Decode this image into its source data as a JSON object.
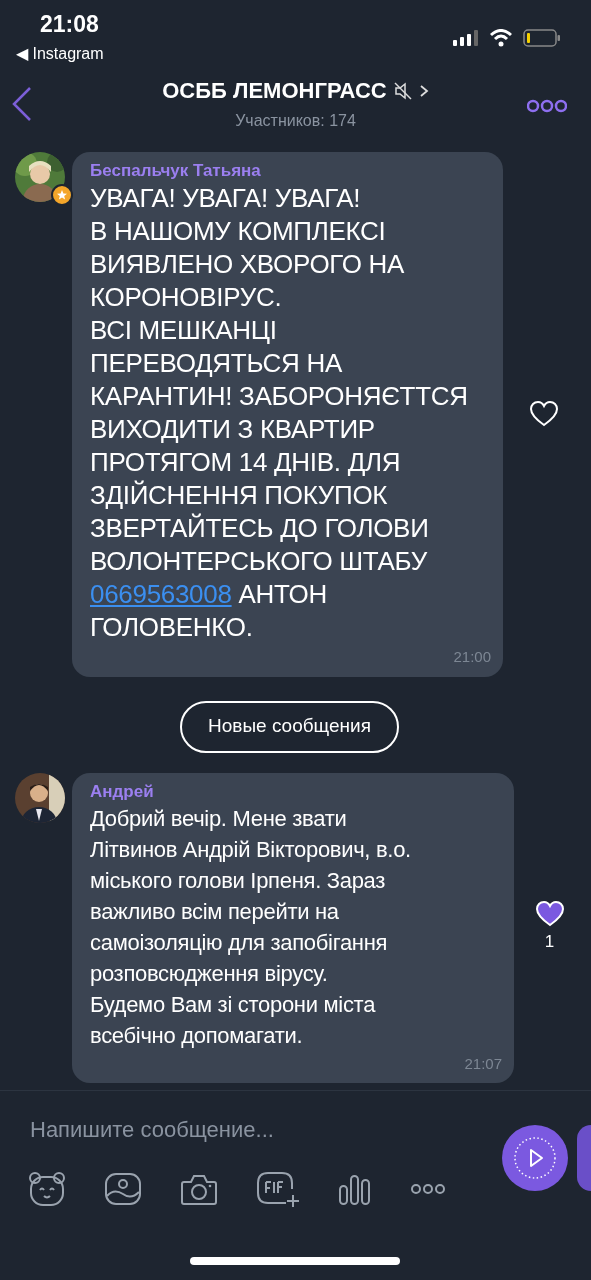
{
  "status_bar": {
    "time": "21:08",
    "back_app": "◀ Instagram"
  },
  "header": {
    "title": "ОСББ ЛЕМОНГРАСС",
    "muted": true,
    "subtitle": "Участников: 174"
  },
  "messages": [
    {
      "sender": "Беспальчук Татьяна",
      "admin": true,
      "kind": "alert",
      "text_before": "УВАГА! УВАГА! УВАГА!\nВ НАШОМУ КОМПЛЕКСІ\nВИЯВЛЕНО ХВОРОГО НА\nКОРОНОВІРУС.\nВСІ МЕШКАНЦІ\nПЕРЕВОДЯТЬСЯ НА\nКАРАНТИН! ЗАБОРОНЯЄТТСЯ\nВИХОДИТИ З КВАРТИР\nПРОТЯГОМ 14 ДНІВ. ДЛЯ\nЗДІЙСНЕННЯ ПОКУПОК\nЗВЕРТАЙТЕСЬ ДО ГОЛОВИ\nВОЛОНТЕРСЬКОГО ШТАБУ\n",
      "link": "0669563008",
      "text_after": " АНТОН\nГОЛОВЕНКО.",
      "time": "21:00",
      "liked": false
    },
    {
      "sender": "Андрей",
      "admin": false,
      "kind": "text",
      "text_before": "Добрий вечір. Мене звати\nЛітвинов Андрій Вікторович, в.о.\nміського голови Ірпеня. Зараз\nважливо всім перейти на\nсамоізоляцію для запобігання\nрозповсюдження вірусу.\nБудемо Вам зі сторони міста\nвсебічно допомагати.",
      "time": "21:07",
      "liked": true,
      "like_count": "1"
    }
  ],
  "new_messages_label": "Новые сообщения",
  "composer": {
    "placeholder": "Напишите сообщение..."
  }
}
